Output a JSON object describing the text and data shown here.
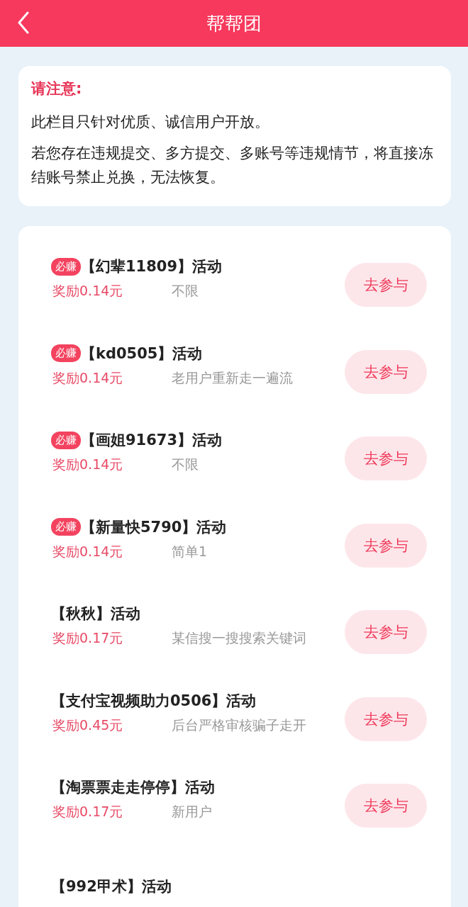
{
  "header": {
    "title": "帮帮团"
  },
  "notice": {
    "title": "请注意:",
    "paragraphs": [
      "此栏目只针对优质、诚信用户开放。",
      "若您存在违规提交、多方提交、多账号等违规情节，将直接冻结账号禁止兑换，无法恢复。"
    ]
  },
  "activities": [
    {
      "badge": "必赚",
      "title": "【幻辈11809】活动",
      "reward": "奖励0.14元",
      "note": "不限",
      "button": "去参与"
    },
    {
      "badge": "必赚",
      "title": "【kd0505】活动",
      "reward": "奖励0.14元",
      "note": "老用户重新走一遍流",
      "button": "去参与"
    },
    {
      "badge": "必赚",
      "title": "【画姐91673】活动",
      "reward": "奖励0.14元",
      "note": "不限",
      "button": "去参与"
    },
    {
      "badge": "必赚",
      "title": "【新量快5790】活动",
      "reward": "奖励0.14元",
      "note": "简单1",
      "button": "去参与"
    },
    {
      "title": "【秋秋】活动",
      "reward": "奖励0.17元",
      "note": "某信搜一搜搜索关键词",
      "button": "去参与"
    },
    {
      "title": "【支付宝视频助力0506】活动",
      "reward": "奖励0.45元",
      "note": "后台严格审核骗子走开",
      "button": "去参与"
    },
    {
      "title": "【淘票票走走停停】活动",
      "reward": "奖励0.17元",
      "note": "新用户",
      "button": "去参与"
    },
    {
      "title": "【992甲术】活动"
    }
  ]
}
